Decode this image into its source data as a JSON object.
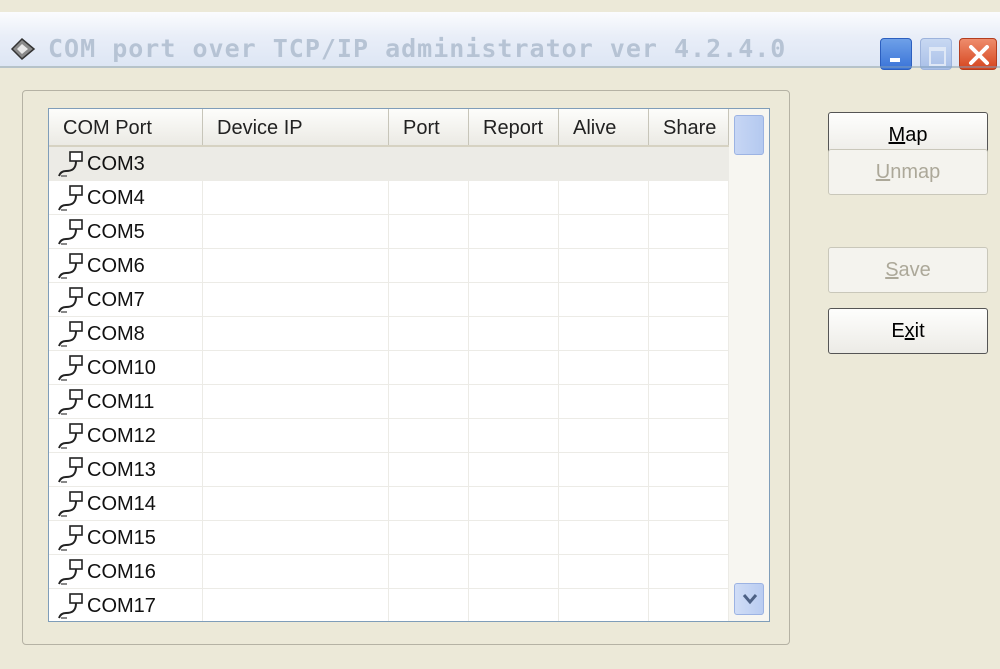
{
  "window": {
    "title": "COM port over TCP/IP administrator ver 4.2.4.0",
    "controls": {
      "minimize": "minimize-icon",
      "maximize": "maximize-icon",
      "close": "close-icon"
    }
  },
  "list": {
    "columns": [
      "COM Port",
      "Device IP",
      "Port",
      "Report",
      "Alive",
      "Share"
    ],
    "rows": [
      {
        "com": "COM3",
        "selected": true
      },
      {
        "com": "COM4"
      },
      {
        "com": "COM5"
      },
      {
        "com": "COM6"
      },
      {
        "com": "COM7"
      },
      {
        "com": "COM8"
      },
      {
        "com": "COM10"
      },
      {
        "com": "COM11"
      },
      {
        "com": "COM12"
      },
      {
        "com": "COM13"
      },
      {
        "com": "COM14"
      },
      {
        "com": "COM15"
      },
      {
        "com": "COM16"
      },
      {
        "com": "COM17"
      }
    ]
  },
  "buttons": {
    "map": {
      "pre": "",
      "acc": "M",
      "post": "ap",
      "enabled": true
    },
    "unmap": {
      "pre": "",
      "acc": "U",
      "post": "nmap",
      "enabled": false
    },
    "save": {
      "pre": "",
      "acc": "S",
      "post": "ave",
      "enabled": false
    },
    "exit": {
      "pre": "E",
      "acc": "x",
      "post": "it",
      "enabled": true
    }
  },
  "colors": {
    "accent": "#3a74d8",
    "close": "#d6461f",
    "window_bg": "#ece9d8"
  }
}
